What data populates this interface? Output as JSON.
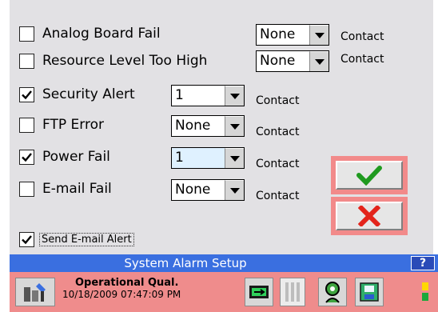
{
  "alarms": [
    {
      "label": "Analog Board Fail",
      "checked": false,
      "select_value": "None",
      "contact": "Contact"
    },
    {
      "label": "Resource Level Too High",
      "checked": false,
      "select_value": "None",
      "contact": "Contact"
    },
    {
      "label": "Security Alert",
      "checked": true,
      "select_value": "1",
      "contact": "Contact"
    },
    {
      "label": "FTP Error",
      "checked": false,
      "select_value": "None",
      "contact": "Contact"
    },
    {
      "label": "Power Fail",
      "checked": true,
      "select_value": "1",
      "contact": "Contact"
    },
    {
      "label": "E-mail Fail",
      "checked": false,
      "select_value": "None",
      "contact": "Contact"
    }
  ],
  "send_email": {
    "label": "Send E-mail Alert",
    "checked": true
  },
  "title": "System Alarm Setup",
  "help_label": "?",
  "status": {
    "line1": "Operational Qual.",
    "line2": "10/18/2009 07:47:09 PM"
  },
  "colors": {
    "accent": "#3a6fe0",
    "status_bg": "#ef8c8c",
    "ok": "#1f9a1f",
    "cancel": "#e3241b"
  }
}
